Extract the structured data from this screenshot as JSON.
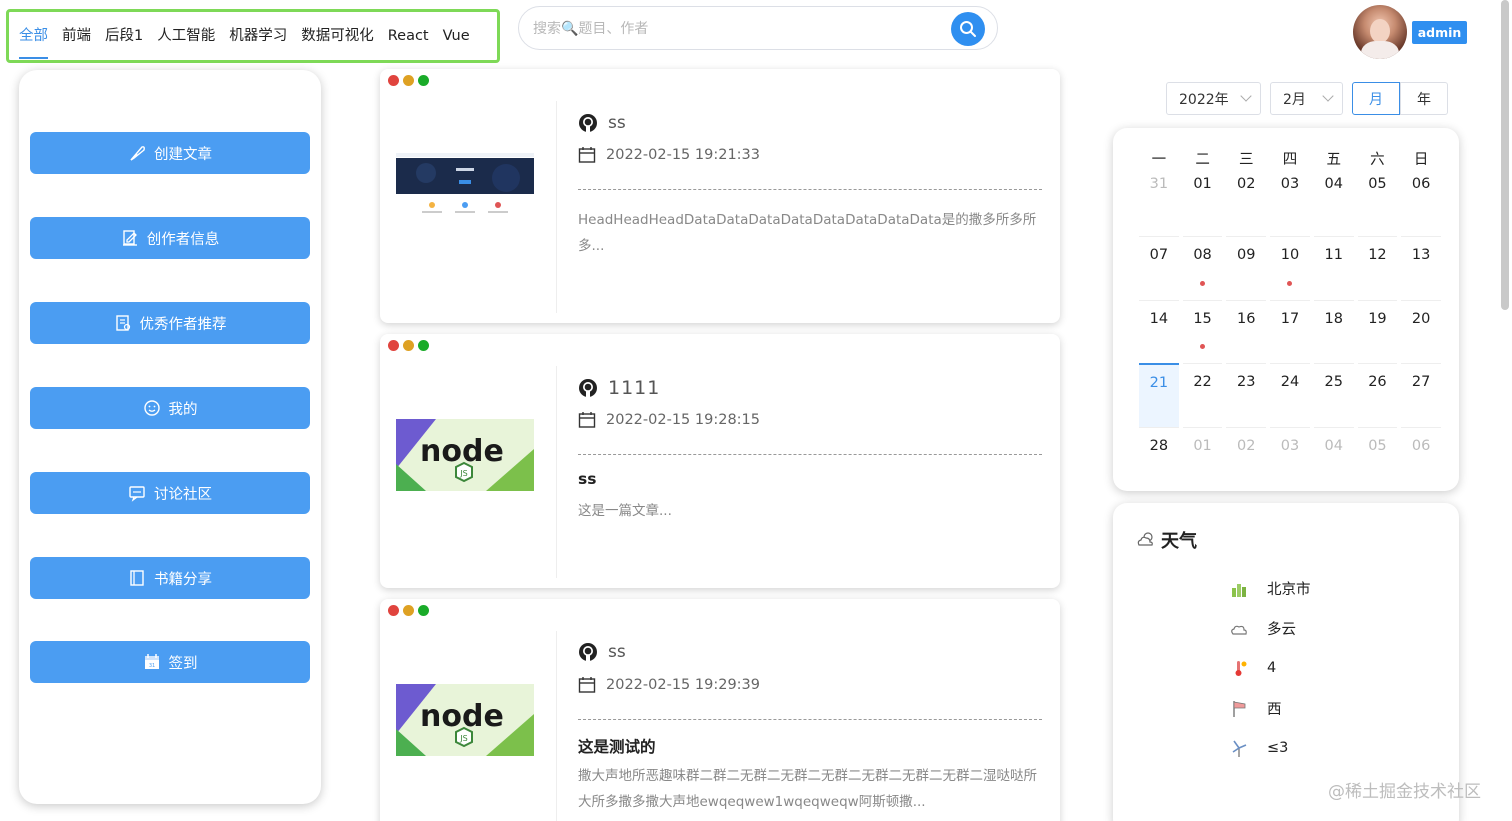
{
  "nav": {
    "items": [
      "全部",
      "前端",
      "后段1",
      "人工智能",
      "机器学习",
      "数据可视化",
      "React",
      "Vue"
    ],
    "active_index": 0
  },
  "search": {
    "placeholder": "搜索🔍题目、作者"
  },
  "user": {
    "badge": "admin"
  },
  "sidebar": {
    "items": [
      {
        "label": "创建文章",
        "icon": "feather-icon"
      },
      {
        "label": "创作者信息",
        "icon": "edit-doc-icon"
      },
      {
        "label": "优秀作者推荐",
        "icon": "reading-icon"
      },
      {
        "label": "我的",
        "icon": "smile-icon"
      },
      {
        "label": "讨论社区",
        "icon": "chat-icon"
      },
      {
        "label": "书籍分享",
        "icon": "book-icon"
      },
      {
        "label": "签到",
        "icon": "calendar-check-icon"
      }
    ]
  },
  "articles": [
    {
      "title": "ss",
      "date": "2022-02-15 19:21:33",
      "heading": "",
      "body": "HeadHeadHeadDataDataDataDataDataDataDataData是的撒多所多所多...",
      "thumb": "website"
    },
    {
      "title": "1111",
      "date": "2022-02-15 19:28:15",
      "heading": "ss",
      "body": "这是一篇文章...",
      "thumb": "node"
    },
    {
      "title": "ss",
      "date": "2022-02-15 19:29:39",
      "heading": "这是测试的",
      "body": "撒大声地所恶趣味群二群二无群二无群二无群二无群二无群二无群二湿哒哒所大所多撒多撒大声地ewqeqwew1wqeqweqw阿斯顿撒...",
      "thumb": "node"
    }
  ],
  "calendar": {
    "year_label": "2022年",
    "month_label": "2月",
    "mode_month": "月",
    "mode_year": "年",
    "weekdays": [
      "一",
      "二",
      "三",
      "四",
      "五",
      "六",
      "日"
    ],
    "weeks": [
      [
        {
          "d": "31",
          "dim": true
        },
        {
          "d": "01"
        },
        {
          "d": "02"
        },
        {
          "d": "03"
        },
        {
          "d": "04"
        },
        {
          "d": "05"
        },
        {
          "d": "06"
        }
      ],
      [
        {
          "d": "07"
        },
        {
          "d": "08",
          "mark": true
        },
        {
          "d": "09"
        },
        {
          "d": "10",
          "mark": true
        },
        {
          "d": "11"
        },
        {
          "d": "12"
        },
        {
          "d": "13"
        }
      ],
      [
        {
          "d": "14"
        },
        {
          "d": "15",
          "mark": true
        },
        {
          "d": "16"
        },
        {
          "d": "17"
        },
        {
          "d": "18"
        },
        {
          "d": "19"
        },
        {
          "d": "20"
        }
      ],
      [
        {
          "d": "21",
          "today": true
        },
        {
          "d": "22"
        },
        {
          "d": "23"
        },
        {
          "d": "24"
        },
        {
          "d": "25"
        },
        {
          "d": "26"
        },
        {
          "d": "27"
        }
      ],
      [
        {
          "d": "28"
        },
        {
          "d": "01",
          "dim": true
        },
        {
          "d": "02",
          "dim": true
        },
        {
          "d": "03",
          "dim": true
        },
        {
          "d": "04",
          "dim": true
        },
        {
          "d": "05",
          "dim": true
        },
        {
          "d": "06",
          "dim": true
        }
      ]
    ]
  },
  "weather": {
    "title": "天气",
    "rows": [
      {
        "icon": "city-icon",
        "value": "北京市"
      },
      {
        "icon": "cloud-icon",
        "value": "多云"
      },
      {
        "icon": "temperature-icon",
        "value": "4"
      },
      {
        "icon": "wind-direction-icon",
        "value": "西"
      },
      {
        "icon": "wind-power-icon",
        "value": "≤3"
      }
    ]
  },
  "watermark": "@稀土掘金技术社区",
  "colors": {
    "accent": "#3a8ee6",
    "button": "#4b9df2",
    "nav_border": "#7ed957",
    "dot_red": "#e0443e",
    "dot_yellow": "#dea123",
    "dot_green": "#1aab29"
  }
}
